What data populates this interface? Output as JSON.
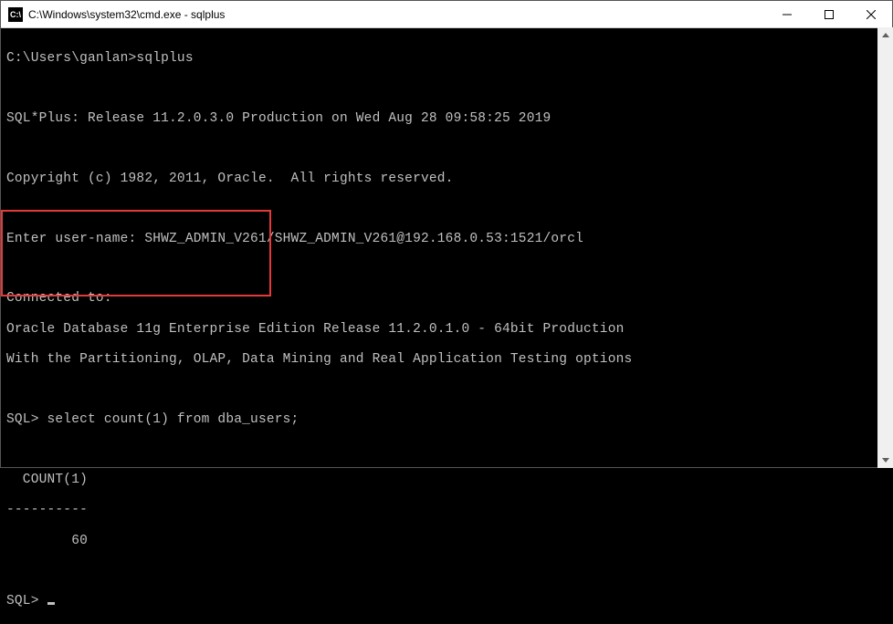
{
  "window": {
    "title": "C:\\Windows\\system32\\cmd.exe - sqlplus",
    "icon_label": "C:\\"
  },
  "terminal": {
    "line1": "C:\\Users\\ganlan>sqlplus",
    "blank": "",
    "line2": "SQL*Plus: Release 11.2.0.3.0 Production on Wed Aug 28 09:58:25 2019",
    "line3": "Copyright (c) 1982, 2011, Oracle.  All rights reserved.",
    "line4": "Enter user-name: SHWZ_ADMIN_V261/SHWZ_ADMIN_V261@192.168.0.53:1521/orcl",
    "line5": "Connected to:",
    "line6": "Oracle Database 11g Enterprise Edition Release 11.2.0.1.0 - 64bit Production",
    "line7": "With the Partitioning, OLAP, Data Mining and Real Application Testing options",
    "line8": "SQL> select count(1) from dba_users;",
    "line9": "  COUNT(1)",
    "line10": "----------",
    "line11": "        60",
    "line12": "SQL> "
  },
  "chart_data": {
    "type": "table",
    "title": "select count(1) from dba_users",
    "series": [
      {
        "name": "COUNT(1)",
        "values": [
          60
        ]
      }
    ]
  }
}
